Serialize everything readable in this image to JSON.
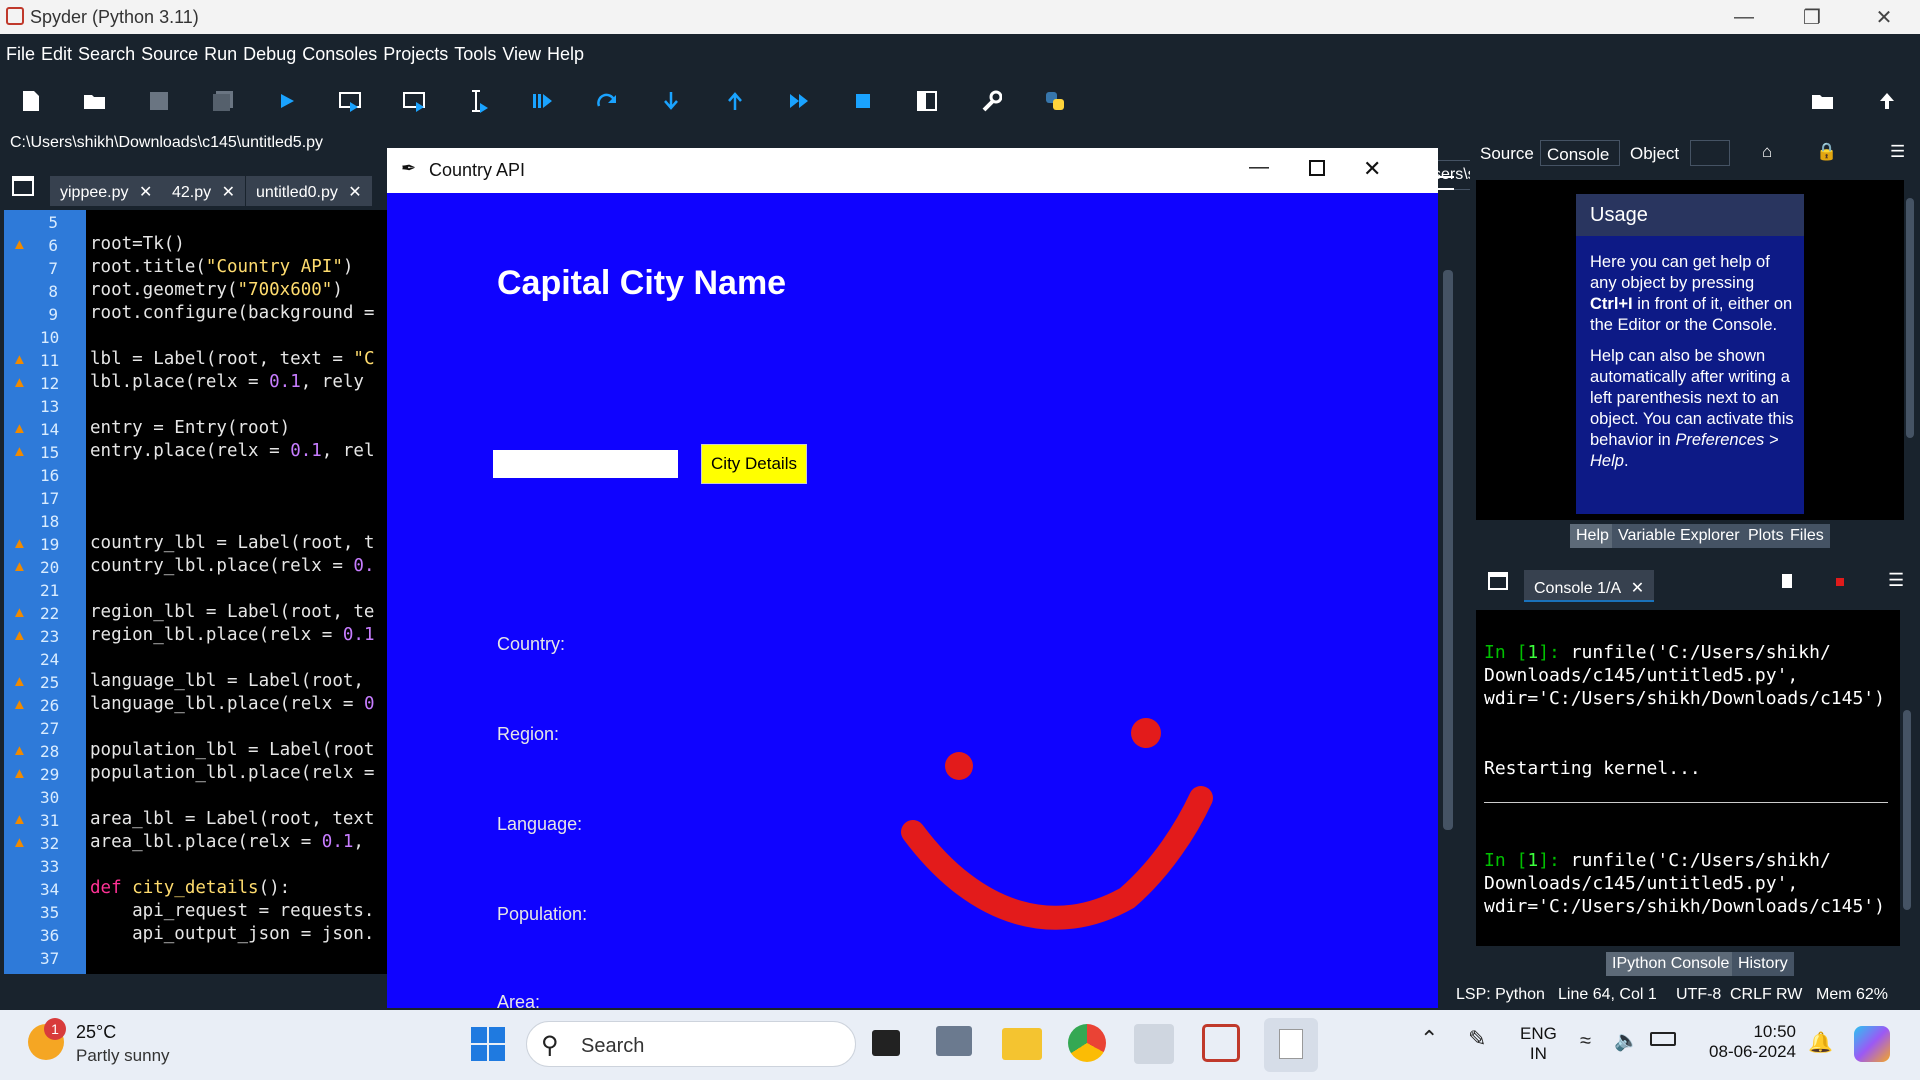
{
  "app": {
    "window_title": "Spyder (Python 3.11)"
  },
  "menu": [
    "File",
    "Edit",
    "Search",
    "Source",
    "Run",
    "Debug",
    "Consoles",
    "Projects",
    "Tools",
    "View",
    "Help"
  ],
  "toolbar": {
    "path": "C:\\Users\\shikh"
  },
  "editor": {
    "file_path": "C:\\Users\\shikh\\Downloads\\c145\\untitled5.py",
    "tabs": [
      "yippee.py",
      "42.py",
      "untitled0.py"
    ],
    "line_numbers": [
      "5",
      "6",
      "7",
      "8",
      "9",
      "10",
      "11",
      "12",
      "13",
      "14",
      "15",
      "16",
      "17",
      "18",
      "19",
      "20",
      "21",
      "22",
      "23",
      "24",
      "25",
      "26",
      "27",
      "28",
      "29",
      "30",
      "31",
      "32",
      "33",
      "34",
      "35",
      "36",
      "37"
    ],
    "warning_lines": [
      "6",
      "11",
      "12",
      "14",
      "15",
      "19",
      "20",
      "22",
      "23",
      "25",
      "26",
      "28",
      "29",
      "31",
      "32"
    ],
    "code": {
      "l6": "root=Tk()",
      "l7a": "root.title(",
      "l7b": "\"Country API\"",
      "l7c": ")",
      "l8a": "root.geometry(",
      "l8b": "\"700x600\"",
      "l8c": ")",
      "l9": "root.configure(background =",
      "l11a": "lbl = Label(root, text = ",
      "l11b": "\"C",
      "l12a": "lbl.place(relx = ",
      "l12b": "0.1",
      "l12c": ", rely",
      "l14": "entry = Entry(root)",
      "l15a": "entry.place(relx = ",
      "l15b": "0.1",
      "l15c": ", rel",
      "l19": "country_lbl = Label(root, t",
      "l20a": "country_lbl.place(relx = ",
      "l20b": "0.",
      "l22": "region_lbl = Label(root, te",
      "l23a": "region_lbl.place(relx = ",
      "l23b": "0.1",
      "l25": "language_lbl = Label(root,",
      "l26a": "language_lbl.place(relx = ",
      "l26b": "0",
      "l28": "population_lbl = Label(root",
      "l29": "population_lbl.place(relx =",
      "l31": "area_lbl = Label(root, text",
      "l32a": "area_lbl.place(relx = ",
      "l32b": "0.1",
      "l32c": ",",
      "l34a": "def ",
      "l34b": "city_details",
      "l34c": "():",
      "l35": "    api_request = requests.",
      "l36": "    api_output_json = json."
    }
  },
  "help_pane": {
    "source_label": "Source",
    "source_value": "Console",
    "object_label": "Object",
    "usage_title": "Usage",
    "p1a": "Here you can get help of any object by pressing ",
    "p1b": "Ctrl+I",
    "p1c": " in front of it, either on the Editor or the Console.",
    "p2a": "Help can also be shown automatically after writing a left parenthesis next to an object. You can activate this behavior in ",
    "p2b": "Preferences > Help",
    "p2c": ".",
    "tabs": [
      "Help",
      "Variable Explorer",
      "Plots",
      "Files"
    ]
  },
  "console": {
    "tab": "Console 1/A",
    "in_prompt": "In [",
    "in_num": "1",
    "in_close": "]: ",
    "cmd1": "runfile('C:/Users/shikh/",
    "cmd2": "Downloads/c145/untitled5.py',",
    "cmd3": "wdir='C:/Users/shikh/Downloads/c145')",
    "restart": "Restarting kernel...",
    "bottom_tabs": [
      "IPython Console",
      "History"
    ]
  },
  "statusbar": {
    "lsp": "LSP: Python",
    "pos": "Line 64, Col 1",
    "enc": "UTF-8",
    "eol": "CRLF",
    "rw": "RW",
    "mem": "Mem 62%"
  },
  "tk_window": {
    "title": "Country API",
    "heading": "Capital City Name",
    "button": "City Details",
    "labels": [
      "Country:",
      "Region:",
      "Language:",
      "Population:",
      "Area:"
    ],
    "bg_color": "#0f03ff",
    "button_color": "#ffff00"
  },
  "taskbar": {
    "weather_temp": "25°C",
    "weather_desc": "Partly sunny",
    "weather_badge": "1",
    "search": "Search",
    "lang1": "ENG",
    "lang2": "IN",
    "time": "10:50",
    "date": "08-06-2024"
  }
}
